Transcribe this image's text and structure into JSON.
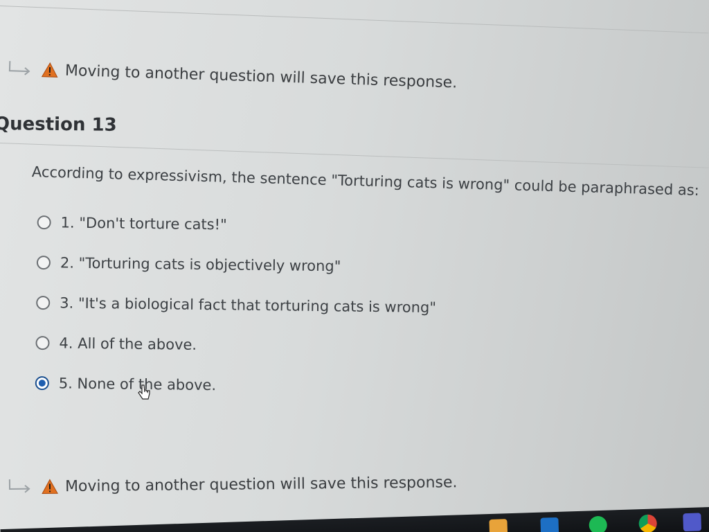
{
  "warning_top": {
    "text": "Moving to another question will save this response."
  },
  "question": {
    "title": "Question 13",
    "prompt": "According to expressivism, the sentence \"Torturing cats is wrong\" could be paraphrased as:",
    "options": [
      {
        "label": "1. \"Don't torture cats!\"",
        "selected": false
      },
      {
        "label": "2. \"Torturing cats is objectively wrong\"",
        "selected": false
      },
      {
        "label": "3. \"It's a biological fact that torturing cats is wrong\"",
        "selected": false
      },
      {
        "label": "4. All of the above.",
        "selected": false
      },
      {
        "label": "5. None of the above.",
        "selected": true
      }
    ]
  },
  "warning_bottom": {
    "text": "Moving to another question will save this response."
  },
  "icons": {
    "arrow": "return-arrow-icon",
    "warning": "warning-triangle-icon",
    "cursor": "pointer-cursor-icon"
  },
  "colors": {
    "warning_orange": "#e07020",
    "selected_blue": "#1f5fb0",
    "text": "#3b3f43"
  },
  "taskbar": {
    "apps": [
      "file-explorer-icon",
      "outlook-icon",
      "spotify-icon",
      "chrome-icon",
      "teams-icon"
    ]
  }
}
